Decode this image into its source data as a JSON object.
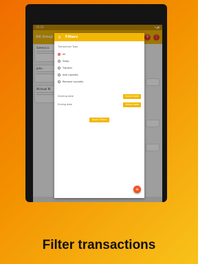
{
  "app": {
    "title": "DK Emoji Khata",
    "status_time": "10:16",
    "status_icons": "▾◢▮"
  },
  "background_list": {
    "customers": [
      {
        "name": "Simma U."
      },
      {
        "name": "John"
      },
      {
        "name": "Michael M."
      }
    ],
    "right_chips": [
      "",
      "",
      ""
    ],
    "bottom_text": ""
  },
  "dialog": {
    "title": "Filters",
    "section_label": "Transaction Type",
    "options": [
      {
        "label": "All",
        "checked": true
      },
      {
        "label": "Swap",
        "checked": false
      },
      {
        "label": "Transfer",
        "checked": false
      },
      {
        "label": "Add Liquidity",
        "checked": false
      },
      {
        "label": "Remove Liquidity",
        "checked": false
      }
    ],
    "starting_date_label": "Starting date",
    "ending_date_label": "Ending date",
    "select_date_label": "Select date",
    "apply_label": "Apply Filters"
  },
  "fab_icon": "filter-icon",
  "caption": "Filter transactions",
  "colors": {
    "accent": "#f2b705",
    "danger": "#e53935",
    "fab": "#f4511e"
  }
}
